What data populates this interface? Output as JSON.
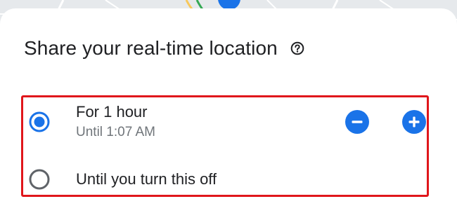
{
  "dialog": {
    "title": "Share your real-time location",
    "help_icon": "help-circle-icon"
  },
  "options": [
    {
      "label": "For 1 hour",
      "sublabel": "Until 1:07 AM",
      "selected": true
    },
    {
      "label": "Until you turn this off",
      "selected": false
    }
  ],
  "duration_controls": {
    "decrease_icon": "minus-circle-icon",
    "increase_icon": "plus-circle-icon"
  },
  "colors": {
    "accent": "#1a73e8",
    "highlight_border": "#e0161b",
    "text_primary": "#202124",
    "text_secondary": "#70757a"
  }
}
